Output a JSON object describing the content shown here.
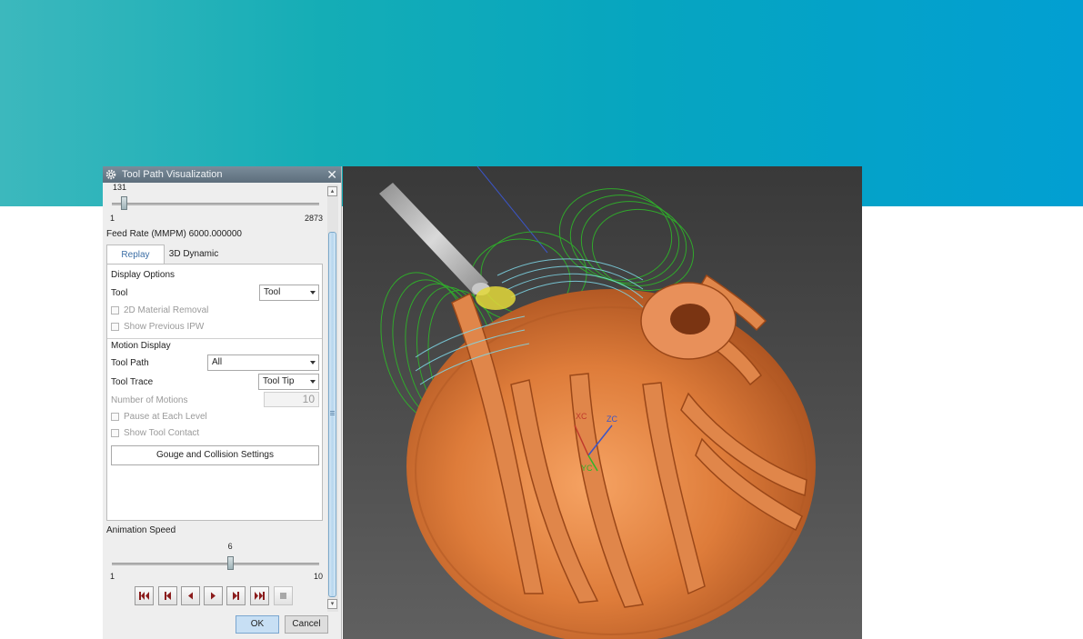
{
  "dialog": {
    "title": "Tool Path Visualization",
    "gear_icon": "gear-icon",
    "close_icon": "close-icon",
    "motion_slider": {
      "current": "131",
      "min": "1",
      "max": "2873",
      "value": 131
    },
    "feed_rate": "Feed Rate (MMPM) 6000.000000",
    "tabs": [
      {
        "label": "Replay",
        "active": true
      },
      {
        "label": "3D Dynamic",
        "active": false
      }
    ],
    "display_options": {
      "heading": "Display Options",
      "tool_label": "Tool",
      "tool_value": "Tool",
      "material_removal_2d": "2D Material Removal",
      "show_previous_ipw": "Show Previous IPW"
    },
    "motion_display": {
      "heading": "Motion Display",
      "tool_path_label": "Tool Path",
      "tool_path_value": "All",
      "tool_trace_label": "Tool Trace",
      "tool_trace_value": "Tool Tip",
      "number_of_motions_label": "Number of Motions",
      "number_of_motions_value": "10",
      "pause_each_level": "Pause at Each Level",
      "show_tool_contact": "Show Tool Contact"
    },
    "gouge_button": "Gouge and Collision Settings",
    "animation_speed": {
      "label": "Animation Speed",
      "current": "6",
      "min": "1",
      "max": "10",
      "value": 6
    },
    "playback": [
      {
        "name": "go-to-start-button",
        "icon": "skip-to-start-icon"
      },
      {
        "name": "step-back-button",
        "icon": "step-back-icon"
      },
      {
        "name": "play-reverse-button",
        "icon": "play-reverse-icon"
      },
      {
        "name": "play-forward-button",
        "icon": "play-forward-icon"
      },
      {
        "name": "step-forward-button",
        "icon": "step-forward-icon"
      },
      {
        "name": "go-to-end-button",
        "icon": "skip-to-end-icon"
      },
      {
        "name": "stop-button",
        "icon": "stop-icon"
      }
    ],
    "ok_label": "OK",
    "cancel_label": "Cancel"
  },
  "viewport": {
    "axis_labels": {
      "xc": "XC",
      "yc": "YC",
      "zc": "ZC"
    }
  },
  "colors": {
    "banner_start": "#3cb8bd",
    "banner_end": "#029fd2",
    "part_orange": "#d9783c",
    "toolpath_green": "#2fb52a",
    "toolpath_cyan": "#7fd8e8",
    "ok_blue": "#c7dff4"
  }
}
